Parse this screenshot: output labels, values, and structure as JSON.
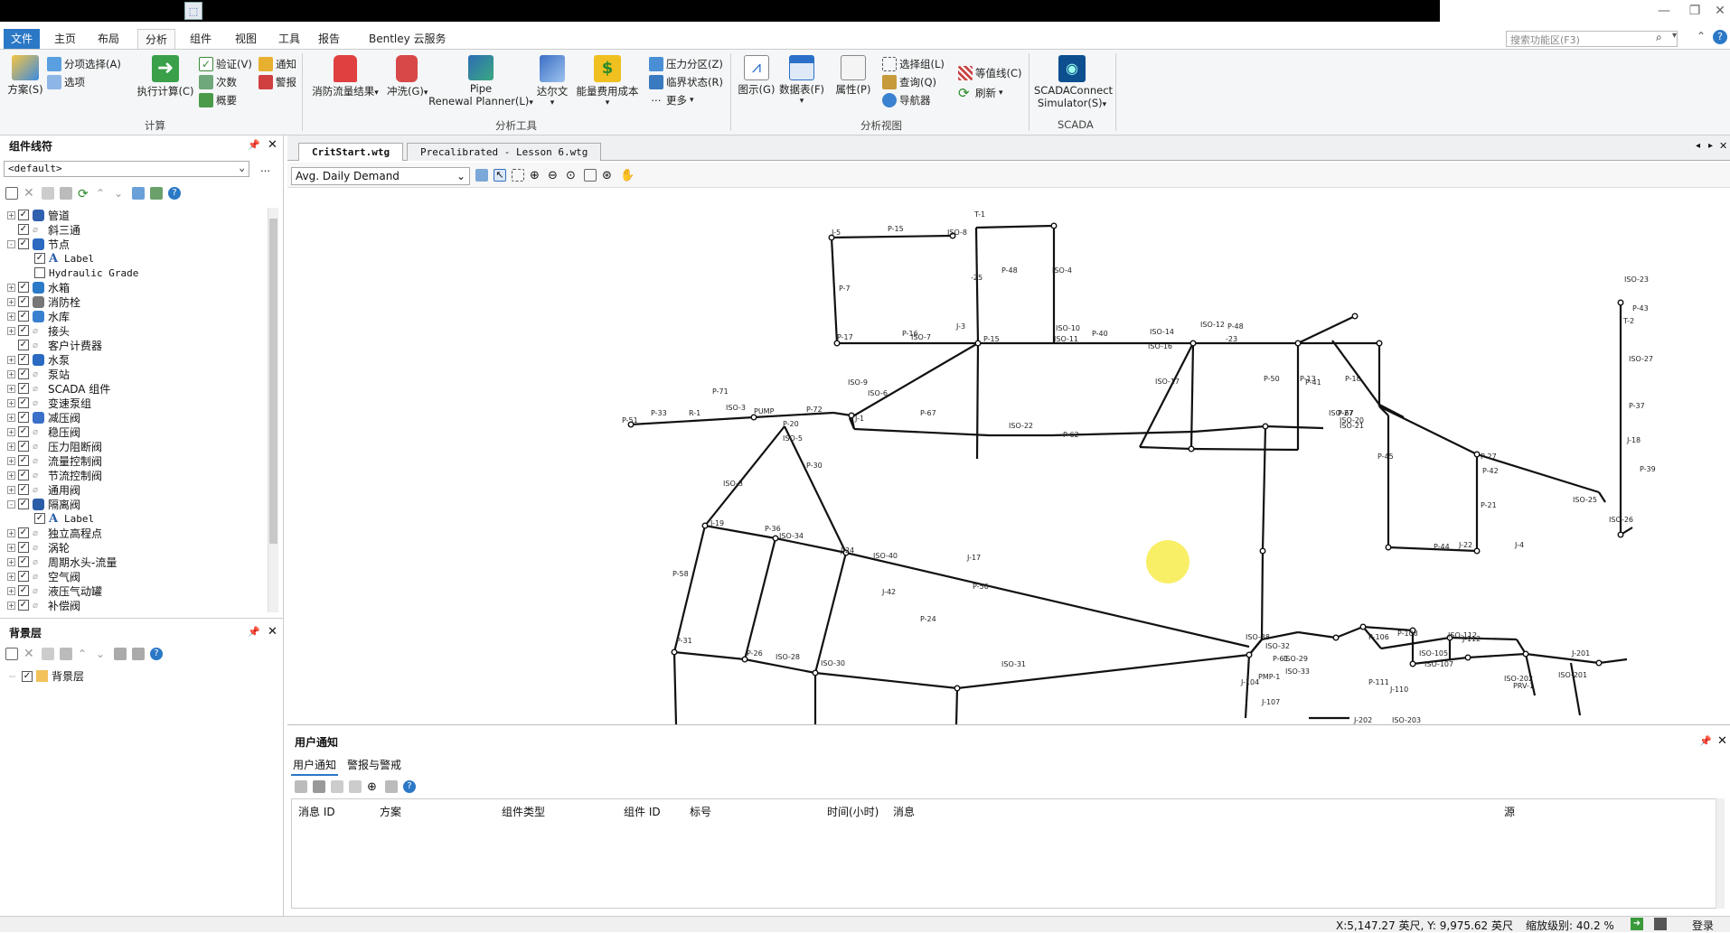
{
  "app": {
    "icon": "hammer-app-icon"
  },
  "menu": {
    "tabs": [
      "文件",
      "主页",
      "布局",
      "分析",
      "组件",
      "视图",
      "工具",
      "报告",
      "Bentley 云服务"
    ],
    "active": "分析",
    "search_placeholder": "搜索功能区(F3)"
  },
  "ribbon": {
    "calc": {
      "scenario": "方案(S)",
      "sub_select": "分项选择(A)",
      "options": "选项",
      "run": "执行计算(C)",
      "validate": "验证(V)",
      "count": "次数",
      "summary": "概要",
      "notify": "通知",
      "alarm": "警报",
      "group": "计算"
    },
    "tools": {
      "fire_flow": "消防流量结果",
      "flush": "冲洗(G)",
      "pipe_line1": "Pipe",
      "pipe_line2": "Renewal Planner(L)",
      "darwin": "达尔文",
      "energy": "能量费用成本",
      "pressure_zone": "压力分区(Z)",
      "critical": "临界状态(R)",
      "more": "更多",
      "group": "分析工具"
    },
    "views": {
      "graph": "图示(G)",
      "datatable": "数据表(F)",
      "property": "属性(P)",
      "select_group": "选择组(L)",
      "query": "查询(Q)",
      "navigator": "导航器",
      "contour": "等值线(C)",
      "refresh": "刷新",
      "group": "分析视图"
    },
    "scada": {
      "line1": "SCADAConnect",
      "line2": "Simulator(S)",
      "group": "SCADA"
    }
  },
  "symbology": {
    "title": "组件线符",
    "dropdown": "<default>",
    "items": [
      {
        "label": "管道",
        "exp": "+",
        "checked": true,
        "indent": 0,
        "icon": "pipe-icon",
        "mono": false
      },
      {
        "label": "斜三通",
        "exp": "",
        "checked": true,
        "indent": 0,
        "icon": "lateral-icon",
        "mono": false
      },
      {
        "label": "节点",
        "exp": "-",
        "checked": true,
        "indent": 0,
        "icon": "junction-icon",
        "mono": false
      },
      {
        "label": "Label",
        "exp": "",
        "checked": true,
        "indent": 1,
        "icon": "label-icon",
        "mono": true
      },
      {
        "label": "Hydraulic Grade",
        "exp": "",
        "checked": false,
        "indent": 1,
        "icon": "none",
        "mono": true
      },
      {
        "label": "水箱",
        "exp": "+",
        "checked": true,
        "indent": 0,
        "icon": "tank-icon",
        "mono": false
      },
      {
        "label": "消防栓",
        "exp": "+",
        "checked": true,
        "indent": 0,
        "icon": "hydrant-icon",
        "mono": false
      },
      {
        "label": "水库",
        "exp": "+",
        "checked": true,
        "indent": 0,
        "icon": "reservoir-icon",
        "mono": false
      },
      {
        "label": "接头",
        "exp": "+",
        "checked": true,
        "indent": 0,
        "icon": "joint-icon",
        "mono": false
      },
      {
        "label": "客户计费器",
        "exp": "",
        "checked": true,
        "indent": 0,
        "icon": "meter-icon",
        "mono": false
      },
      {
        "label": "水泵",
        "exp": "+",
        "checked": true,
        "indent": 0,
        "icon": "pump-icon",
        "mono": false
      },
      {
        "label": "泵站",
        "exp": "+",
        "checked": true,
        "indent": 0,
        "icon": "pump-station-icon",
        "mono": false
      },
      {
        "label": "SCADA 组件",
        "exp": "+",
        "checked": true,
        "indent": 0,
        "icon": "scada-icon",
        "mono": false
      },
      {
        "label": "变速泵组",
        "exp": "+",
        "checked": true,
        "indent": 0,
        "icon": "vsp-icon",
        "mono": false
      },
      {
        "label": "减压阀",
        "exp": "+",
        "checked": true,
        "indent": 0,
        "icon": "prv-icon",
        "mono": false
      },
      {
        "label": "稳压阀",
        "exp": "+",
        "checked": true,
        "indent": 0,
        "icon": "psv-icon",
        "mono": false
      },
      {
        "label": "压力阻断阀",
        "exp": "+",
        "checked": true,
        "indent": 0,
        "icon": "pbv-icon",
        "mono": false
      },
      {
        "label": "流量控制阀",
        "exp": "+",
        "checked": true,
        "indent": 0,
        "icon": "fcv-icon",
        "mono": false
      },
      {
        "label": "节流控制阀",
        "exp": "+",
        "checked": true,
        "indent": 0,
        "icon": "tcv-icon",
        "mono": false
      },
      {
        "label": "通用阀",
        "exp": "+",
        "checked": true,
        "indent": 0,
        "icon": "gpv-icon",
        "mono": false
      },
      {
        "label": "隔离阀",
        "exp": "-",
        "checked": true,
        "indent": 0,
        "icon": "isolation-valve-icon",
        "mono": false
      },
      {
        "label": "Label",
        "exp": "",
        "checked": true,
        "indent": 1,
        "icon": "label-icon",
        "mono": true
      },
      {
        "label": "独立高程点",
        "exp": "+",
        "checked": true,
        "indent": 0,
        "icon": "spot-elevation-icon",
        "mono": false
      },
      {
        "label": "涡轮",
        "exp": "+",
        "checked": true,
        "indent": 0,
        "icon": "turbine-icon",
        "mono": false
      },
      {
        "label": "周期水头-流量",
        "exp": "+",
        "checked": true,
        "indent": 0,
        "icon": "periodic-head-flow-icon",
        "mono": false
      },
      {
        "label": "空气阀",
        "exp": "+",
        "checked": true,
        "indent": 0,
        "icon": "air-valve-icon",
        "mono": false
      },
      {
        "label": "液压气动罐",
        "exp": "+",
        "checked": true,
        "indent": 0,
        "icon": "hydropneumatic-tank-icon",
        "mono": false
      },
      {
        "label": "补偿阀",
        "exp": "+",
        "checked": true,
        "indent": 0,
        "icon": "surge-valve-icon",
        "mono": false
      }
    ]
  },
  "background": {
    "title": "背景层",
    "item": "背景层"
  },
  "docs": {
    "tab1": "CritStart.wtg",
    "tab2": "Precalibrated - Lesson 6.wtg",
    "scenario": "Avg. Daily Demand"
  },
  "map_labels": [
    "T-1",
    "P-15",
    "J-5",
    "P-7",
    "ISO-8",
    "-25",
    "P-48",
    "ISO-4",
    "P-16",
    "P-17",
    "ISO-7",
    "J-3",
    "P-15",
    "ISO-10",
    "ISO-11",
    "P-40",
    "ISO-14",
    "ISO-16",
    "P-48",
    "-23",
    "ISO-12",
    "ISO-17",
    "P-50",
    "P-13",
    "P-18",
    "P-41",
    "ISO-9",
    "ISO-6",
    "P-51",
    "P-33",
    "R-1",
    "P-71",
    "ISO-3",
    "PUMP",
    "P-72",
    "J-1",
    "P-67",
    "P-67",
    "ISO-20",
    "ISO-21",
    "ISO-22",
    "P-62",
    "ISO-27",
    "P-45",
    "P-20",
    "ISO-5",
    "ISO-3",
    "P-30",
    "P-27",
    "P-42",
    "ISO-25",
    "ISO-26",
    "P-21",
    "J-4",
    "P-44",
    "J-22",
    "ISO-23",
    "P-43",
    "T-2",
    "ISO-27",
    "P-37",
    "J-18",
    "P-39",
    "J-19",
    "P-36",
    "ISO-34",
    "J-24",
    "ISO-40",
    "J-42",
    "P-24",
    "P-56",
    "J-17",
    "P-58",
    "P-31",
    "P-26",
    "ISO-28",
    "ISO-30",
    "ISO-31",
    "ISO-32",
    "ISO-38",
    "P-61",
    "ISO-29",
    "ISO-33",
    "PMP-1",
    "J-104",
    "J-107",
    "P-106",
    "P-108",
    "ISO-105",
    "ISO-107",
    "P-111",
    "J-110",
    "ISO-112",
    "J-112",
    "PRV-1",
    "ISO-201",
    "ISO-202",
    "J-202",
    "ISO-203",
    "J-201"
  ],
  "notify": {
    "title": "用户通知",
    "tab1": "用户通知",
    "tab2": "警报与警戒",
    "cols": [
      "消息 ID",
      "方案",
      "组件类型",
      "组件 ID",
      "标号",
      "时间(小时)",
      "消息",
      "源"
    ]
  },
  "status": {
    "coords": "X:5,147.27 英尺, Y: 9,975.62 英尺",
    "zoom": "缩放级别: 40.2 %",
    "login": "登录"
  }
}
